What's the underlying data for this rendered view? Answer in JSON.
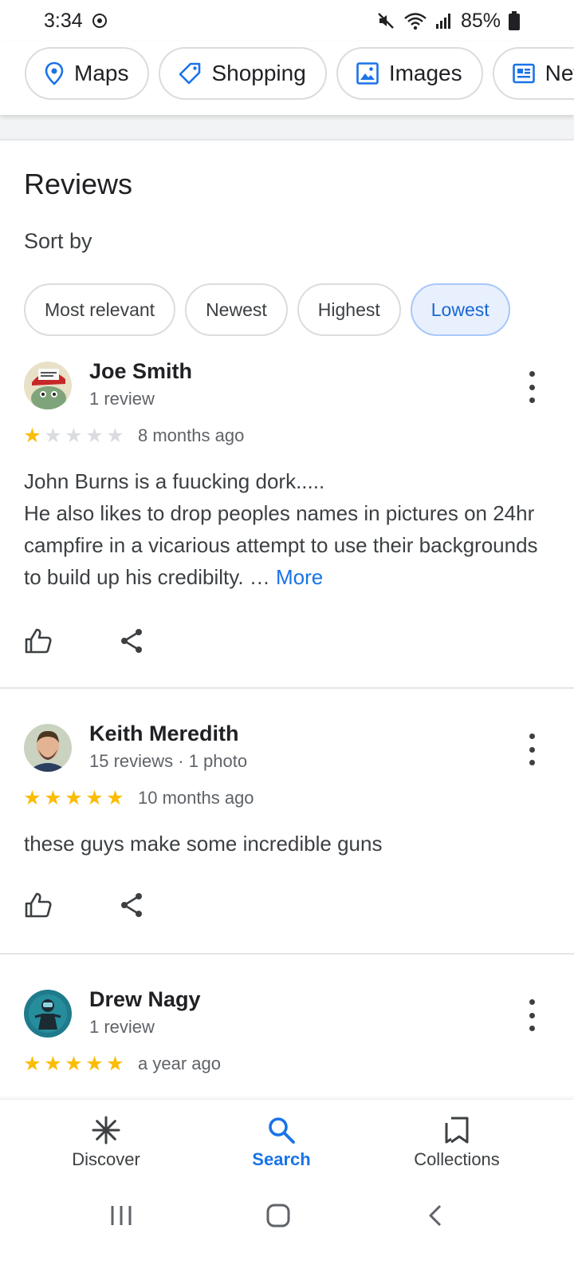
{
  "status": {
    "time": "3:34",
    "battery": "85%"
  },
  "top_chips": [
    {
      "label": "Maps",
      "icon": "map-pin-icon"
    },
    {
      "label": "Shopping",
      "icon": "tag-icon"
    },
    {
      "label": "Images",
      "icon": "image-icon"
    },
    {
      "label": "News",
      "icon": "news-icon"
    }
  ],
  "reviews_section": {
    "title": "Reviews",
    "sort_label": "Sort by",
    "sort_options": [
      "Most relevant",
      "Newest",
      "Highest",
      "Lowest"
    ],
    "selected_sort": "Lowest"
  },
  "reviews": [
    {
      "name": "Joe Smith",
      "meta": "1 review",
      "rating": 1,
      "time": "8 months ago",
      "body_lines": [
        "John Burns is a fuucking dork.....",
        "He also likes to drop peoples names in pictures on 24hr campfire in a vicarious attempt to use their backgrounds to build up his credibilty. …"
      ],
      "more_label": "More"
    },
    {
      "name": "Keith Meredith",
      "meta": "15 reviews · 1 photo",
      "rating": 5,
      "time": "10 months ago",
      "body_lines": [
        "these guys make some incredible guns"
      ]
    },
    {
      "name": "Drew Nagy",
      "meta": "1 review",
      "rating": 5,
      "time": "a year ago"
    }
  ],
  "bottom_nav": [
    {
      "label": "Discover",
      "icon": "asterisk-icon"
    },
    {
      "label": "Search",
      "icon": "search-icon",
      "active": true
    },
    {
      "label": "Collections",
      "icon": "bookmarks-icon"
    }
  ],
  "colors": {
    "accent": "#1a73e8",
    "star": "#fbbc04",
    "star_empty": "#dadce0"
  }
}
